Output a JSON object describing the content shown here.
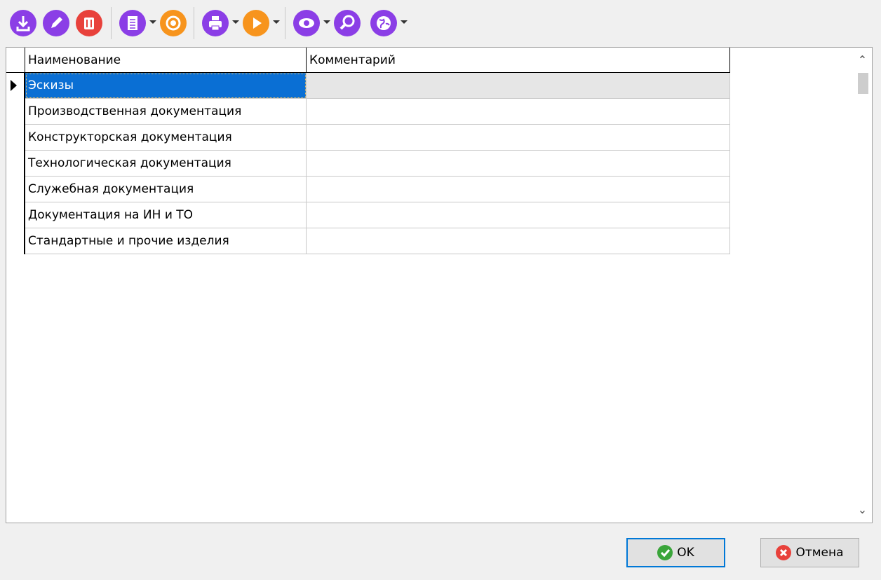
{
  "toolbar": {
    "buttons": [
      {
        "icon": "download-icon",
        "color": "#8b3ee6",
        "has_dropdown": false
      },
      {
        "icon": "pencil-icon",
        "color": "#8b3ee6",
        "has_dropdown": false
      },
      {
        "icon": "trash-icon",
        "color": "#e8413b",
        "has_dropdown": false
      },
      {
        "icon": "document-icon",
        "color": "#8b3ee6",
        "has_dropdown": true
      },
      {
        "icon": "refresh-icon",
        "color": "#f7941d",
        "has_dropdown": false
      },
      {
        "icon": "printer-icon",
        "color": "#8b3ee6",
        "has_dropdown": true
      },
      {
        "icon": "play-icon",
        "color": "#f7941d",
        "has_dropdown": true
      },
      {
        "icon": "eye-icon",
        "color": "#8b3ee6",
        "has_dropdown": true
      },
      {
        "icon": "search-icon",
        "color": "#8b3ee6",
        "has_dropdown": false
      },
      {
        "icon": "globe-icon",
        "color": "#8b3ee6",
        "has_dropdown": true
      }
    ]
  },
  "grid": {
    "columns": [
      "Наименование",
      "Комментарий"
    ],
    "rows": [
      {
        "name": "Эскизы",
        "comment": "",
        "selected": true
      },
      {
        "name": "Производственная документация",
        "comment": ""
      },
      {
        "name": "Конструкторская документация",
        "comment": ""
      },
      {
        "name": "Технологическая документация",
        "comment": ""
      },
      {
        "name": "Служебная документация",
        "comment": ""
      },
      {
        "name": "Документация на ИН и ТО",
        "comment": ""
      },
      {
        "name": "Стандартные и прочие изделия",
        "comment": ""
      }
    ],
    "selection_color": "#0a6fd4"
  },
  "footer": {
    "ok_label": "OK",
    "cancel_label": "Отмена",
    "ok_icon": "checkmark-icon",
    "cancel_icon": "close-icon"
  }
}
